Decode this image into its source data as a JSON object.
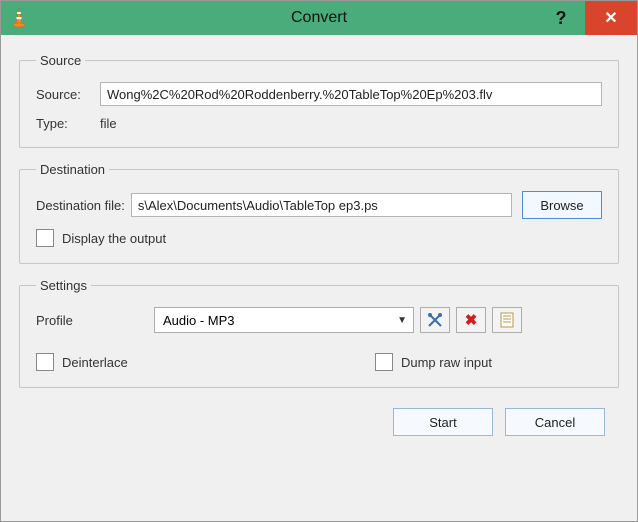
{
  "window": {
    "title": "Convert",
    "help_glyph": "?",
    "close_glyph": "✕"
  },
  "source": {
    "legend": "Source",
    "source_label": "Source:",
    "source_value": "Wong%2C%20Rod%20Roddenberry.%20TableTop%20Ep%203.flv",
    "type_label": "Type:",
    "type_value": "file"
  },
  "destination": {
    "legend": "Destination",
    "dest_label": "Destination file:",
    "dest_value": "s\\Alex\\Documents\\Audio\\TableTop ep3.ps",
    "browse_label": "Browse",
    "display_output_label": "Display the output"
  },
  "settings": {
    "legend": "Settings",
    "profile_label": "Profile",
    "profile_value": "Audio - MP3",
    "deinterlace_label": "Deinterlace",
    "dump_raw_label": "Dump raw input"
  },
  "footer": {
    "start_label": "Start",
    "cancel_label": "Cancel"
  },
  "icons": {
    "tools_glyph": "✕",
    "delete_glyph": "✖",
    "new_glyph": "📄"
  }
}
